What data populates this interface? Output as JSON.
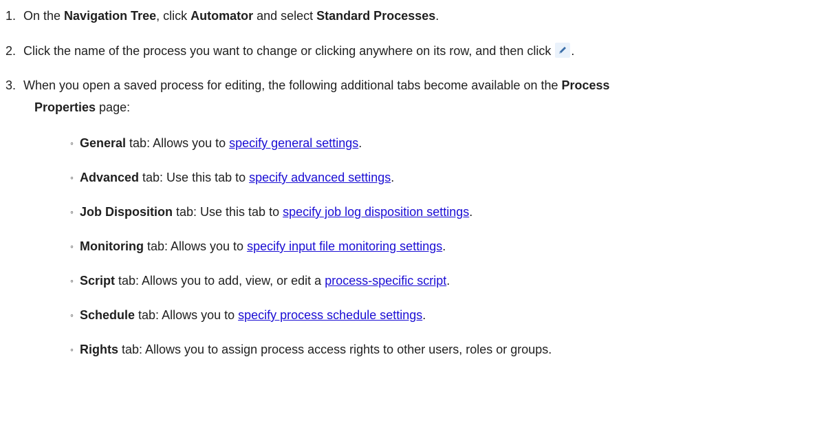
{
  "steps": [
    {
      "number": "1.",
      "segments": [
        {
          "t": "On the ",
          "b": false
        },
        {
          "t": "Navigation Tree",
          "b": true
        },
        {
          "t": ", click ",
          "b": false
        },
        {
          "t": "Automator",
          "b": true
        },
        {
          "t": " and select ",
          "b": false
        },
        {
          "t": "Standard Processes",
          "b": true
        },
        {
          "t": ".",
          "b": false
        }
      ]
    },
    {
      "number": "2.",
      "text_before_icon": "Click the name of the process you want to change or clicking anywhere on its row, and then click",
      "icon": "pencil-edit-icon",
      "text_after_icon": "."
    },
    {
      "number": "3.",
      "line1_text": "When you open a saved process for editing, the following additional tabs become available on the ",
      "line1_bold": "Process",
      "line2_bold": "Properties",
      "line2_text": " page:"
    }
  ],
  "tabs": [
    {
      "name": "General",
      "pre": " tab: Allows you to ",
      "link": "specify general settings",
      "post": "."
    },
    {
      "name": "Advanced",
      "pre": " tab: Use this tab to ",
      "link": "specify advanced settings",
      "post": "."
    },
    {
      "name": "Job Disposition",
      "pre": " tab: Use this tab to ",
      "link": "specify job log disposition settings",
      "post": "."
    },
    {
      "name": "Monitoring",
      "pre": " tab: Allows you to ",
      "link": "specify input file monitoring settings",
      "post": "."
    },
    {
      "name": "Script",
      "pre": " tab: Allows you to add, view, or edit a ",
      "link": "process-specific script",
      "post": "."
    },
    {
      "name": "Schedule",
      "pre": " tab: Allows you to ",
      "link": "specify process schedule settings",
      "post": "."
    },
    {
      "name": "Rights",
      "pre": " tab: Allows you to assign process access rights to other users, roles or groups.",
      "link": "",
      "post": ""
    }
  ],
  "bullet_glyph": "◦",
  "colors": {
    "text": "#1f1f1f",
    "link": "#1a0dd4",
    "icon_bg": "#eaf2fb",
    "icon_pen": "#3b6ea8"
  }
}
